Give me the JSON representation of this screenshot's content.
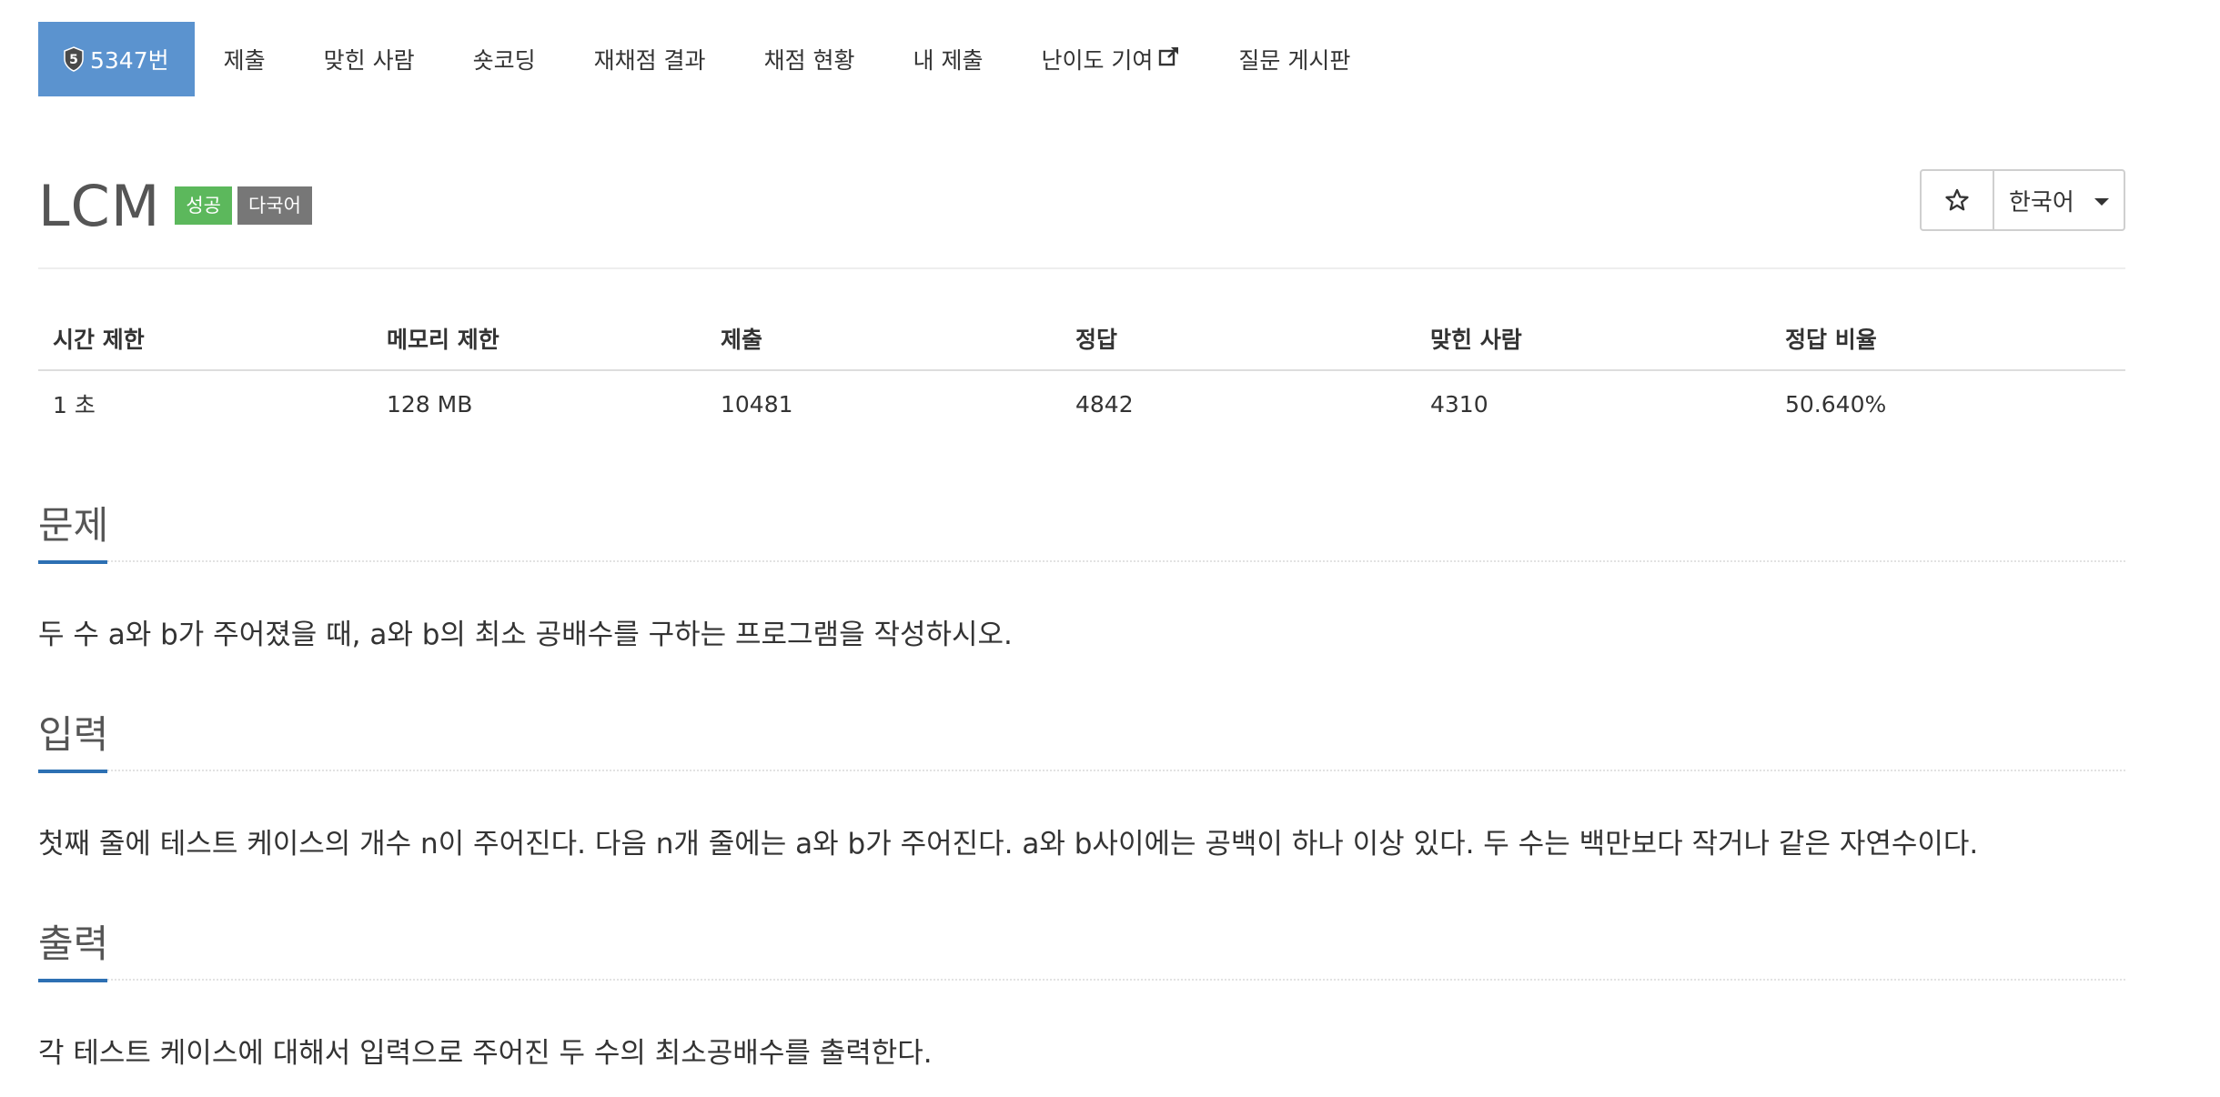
{
  "nav": {
    "problem_number": "5347번",
    "shield_digit": "5",
    "items": [
      {
        "label": "제출"
      },
      {
        "label": "맞힌 사람"
      },
      {
        "label": "숏코딩"
      },
      {
        "label": "재채점 결과"
      },
      {
        "label": "채점 현황"
      },
      {
        "label": "내 제출"
      },
      {
        "label": "난이도 기여"
      },
      {
        "label": "질문 게시판"
      }
    ]
  },
  "problem": {
    "title": "LCM",
    "labels": {
      "success": "성공",
      "multilang": "다국어"
    },
    "language": "한국어"
  },
  "info_table": {
    "headers": [
      "시간 제한",
      "메모리 제한",
      "제출",
      "정답",
      "맞힌 사람",
      "정답 비율"
    ],
    "values": [
      "1 초",
      "128 MB",
      "10481",
      "4842",
      "4310",
      "50.640%"
    ]
  },
  "sections": {
    "description": {
      "title": "문제",
      "text": "두 수 a와 b가 주어졌을 때, a와 b의 최소 공배수를 구하는 프로그램을 작성하시오."
    },
    "input": {
      "title": "입력",
      "text": "첫째 줄에 테스트 케이스의 개수 n이 주어진다. 다음 n개 줄에는 a와 b가 주어진다. a와 b사이에는 공백이 하나 이상 있다. 두 수는 백만보다 작거나 같은 자연수이다."
    },
    "output": {
      "title": "출력",
      "text": "각 테스트 케이스에 대해서 입력으로 주어진 두 수의 최소공배수를 출력한다."
    }
  },
  "colors": {
    "accent": "#5b93cf",
    "section_underline": "#2d70b3",
    "label_success": "#5cb85c",
    "label_multilang": "#777777"
  }
}
